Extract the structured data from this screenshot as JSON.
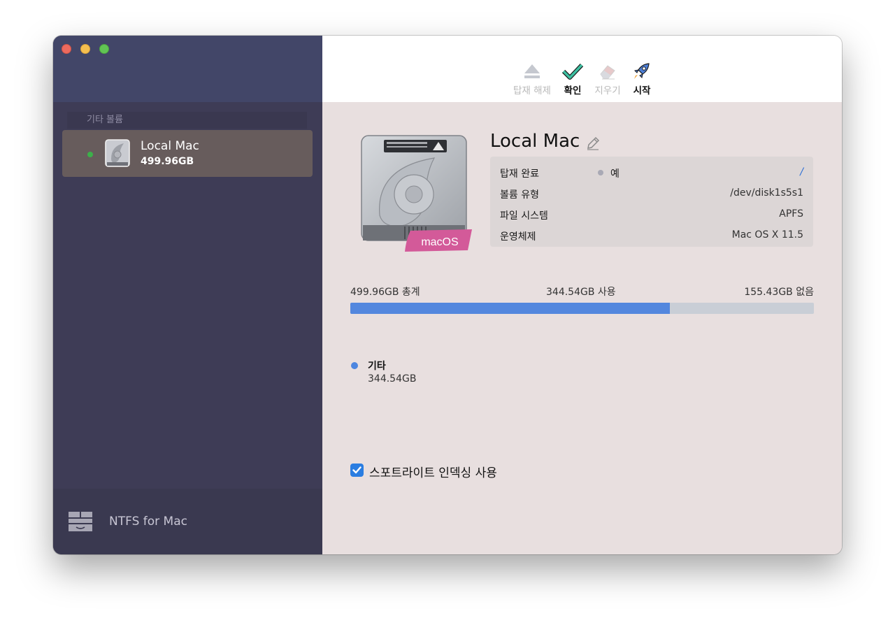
{
  "window": {
    "traffic_lights": [
      "close",
      "minimize",
      "maximize"
    ]
  },
  "sidebar": {
    "section_header": "기타 볼륨",
    "items": [
      {
        "name": "Local Mac",
        "size": "499.96GB",
        "status_color": "#3cb04a",
        "icon": "hard-disk-icon"
      }
    ],
    "footer": {
      "app_name": "NTFS for Mac",
      "icon": "ntfs-app-icon"
    }
  },
  "toolbar": {
    "unmount_label": "탑재 해제",
    "verify_label": "확인",
    "erase_label": "지우기",
    "launch_label": "시작"
  },
  "volume": {
    "title": "Local Mac",
    "badge": "macOS",
    "info": [
      {
        "label": "탑재 완료",
        "mid": "예",
        "value": "/"
      },
      {
        "label": "볼륨 유형",
        "value": "/dev/disk1s5s1"
      },
      {
        "label": "파일 시스템",
        "value": "APFS"
      },
      {
        "label": "운영체제",
        "value": "Mac OS X 11.5"
      }
    ]
  },
  "usage": {
    "total_label": "499.96GB 총계",
    "used_label": "344.54GB 사용",
    "free_label": "155.43GB 없음",
    "used_fraction": 0.689,
    "legend": {
      "name": "기타",
      "value": "344.54GB",
      "color": "#4c86e0"
    }
  },
  "options": {
    "spotlight_label": "스포트라이트 인덱싱 사용",
    "spotlight_checked": true
  },
  "colors": {
    "accent": "#2a7de1",
    "badge": "#d24f8f",
    "sidebar": "#3e3c56",
    "selected_item": "#675c5c"
  }
}
